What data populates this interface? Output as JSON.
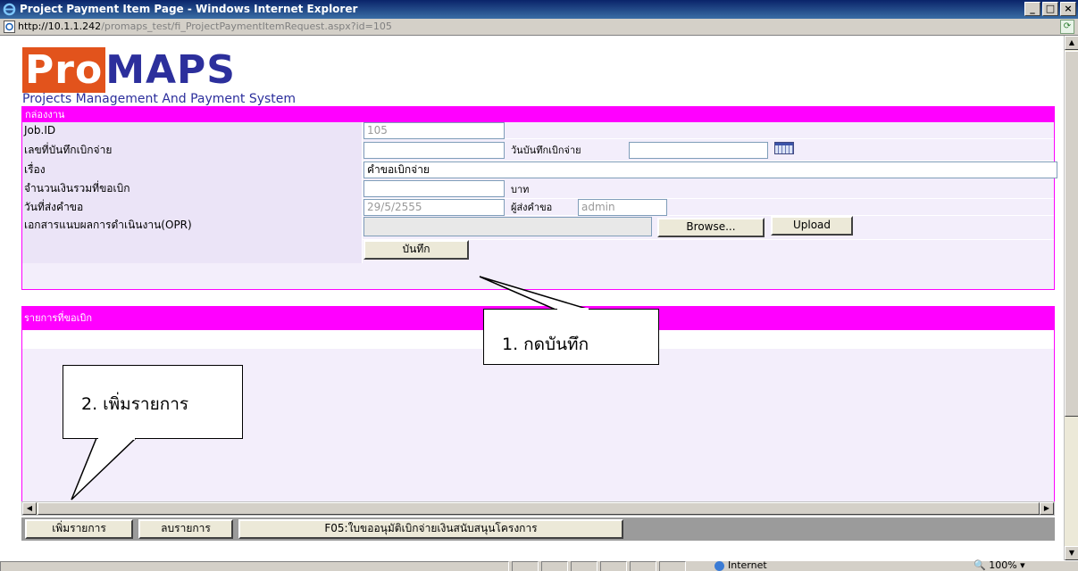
{
  "window": {
    "title": "Project Payment Item Page - Windows Internet Explorer",
    "url_host": "http://10.1.1.242",
    "url_path": "/promaps_test/fi_ProjectPaymentItemRequest.aspx?id=105",
    "minimize_label": "_",
    "maximize_label": "□",
    "close_label": "×"
  },
  "logo": {
    "pro": "Pro",
    "maps": "MAPS",
    "subtitle": "Projects Management And Payment System"
  },
  "form": {
    "header": "กล่องงาน",
    "job_id_label": "Job.ID",
    "job_id_value": "105",
    "record_no_label": "เลขที่บันทึกเบิกจ่าย",
    "record_no_value": "",
    "record_date_label": "วันบันทึกเบิกจ่าย",
    "record_date_value": "",
    "subject_label": "เรื่อง",
    "subject_value": "คำขอเบิกจ่าย",
    "amount_label": "จำนวนเงินรวมที่ขอเบิก",
    "amount_value": "",
    "amount_unit": "บาท",
    "submit_date_label": "วันที่ส่งคำขอ",
    "submit_date_value": "29/5/2555",
    "submitter_label": "ผู้ส่งคำขอ",
    "submitter_value": "admin",
    "opr_label": "เอกสารแนบผลการดำเนินงาน(OPR)",
    "opr_value": "",
    "browse_label": "Browse...",
    "upload_label": "Upload",
    "save_label": "บันทึก"
  },
  "list": {
    "header": "รายการที่ขอเบิก",
    "add_label": "เพิ่มรายการ",
    "delete_label": "ลบรายการ",
    "f05_label": "F05:ใบขออนุมัติเบิกจ่ายเงินสนับสนุนโครงการ"
  },
  "callouts": {
    "one": "1. กดบันทึก",
    "two": "2. เพิ่มรายการ"
  },
  "status": {
    "zone": "Internet",
    "zoom": "100%"
  },
  "colors": {
    "panel_header": "#ff00ff",
    "panel_bg": "#f3eefb",
    "label_bg": "#ebe4f7",
    "logo_orange": "#e2531c",
    "logo_blue": "#2c2f9c"
  }
}
